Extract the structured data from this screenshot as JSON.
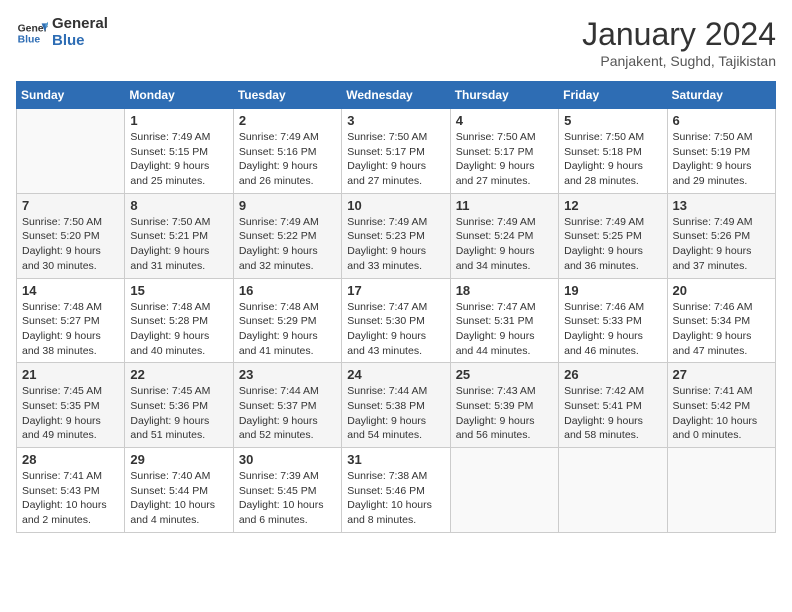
{
  "header": {
    "logo_line1": "General",
    "logo_line2": "Blue",
    "month": "January 2024",
    "location": "Panjakent, Sughd, Tajikistan"
  },
  "days_of_week": [
    "Sunday",
    "Monday",
    "Tuesday",
    "Wednesday",
    "Thursday",
    "Friday",
    "Saturday"
  ],
  "weeks": [
    [
      {
        "day": "",
        "info": ""
      },
      {
        "day": "1",
        "info": "Sunrise: 7:49 AM\nSunset: 5:15 PM\nDaylight: 9 hours\nand 25 minutes."
      },
      {
        "day": "2",
        "info": "Sunrise: 7:49 AM\nSunset: 5:16 PM\nDaylight: 9 hours\nand 26 minutes."
      },
      {
        "day": "3",
        "info": "Sunrise: 7:50 AM\nSunset: 5:17 PM\nDaylight: 9 hours\nand 27 minutes."
      },
      {
        "day": "4",
        "info": "Sunrise: 7:50 AM\nSunset: 5:17 PM\nDaylight: 9 hours\nand 27 minutes."
      },
      {
        "day": "5",
        "info": "Sunrise: 7:50 AM\nSunset: 5:18 PM\nDaylight: 9 hours\nand 28 minutes."
      },
      {
        "day": "6",
        "info": "Sunrise: 7:50 AM\nSunset: 5:19 PM\nDaylight: 9 hours\nand 29 minutes."
      }
    ],
    [
      {
        "day": "7",
        "info": "Sunrise: 7:50 AM\nSunset: 5:20 PM\nDaylight: 9 hours\nand 30 minutes."
      },
      {
        "day": "8",
        "info": "Sunrise: 7:50 AM\nSunset: 5:21 PM\nDaylight: 9 hours\nand 31 minutes."
      },
      {
        "day": "9",
        "info": "Sunrise: 7:49 AM\nSunset: 5:22 PM\nDaylight: 9 hours\nand 32 minutes."
      },
      {
        "day": "10",
        "info": "Sunrise: 7:49 AM\nSunset: 5:23 PM\nDaylight: 9 hours\nand 33 minutes."
      },
      {
        "day": "11",
        "info": "Sunrise: 7:49 AM\nSunset: 5:24 PM\nDaylight: 9 hours\nand 34 minutes."
      },
      {
        "day": "12",
        "info": "Sunrise: 7:49 AM\nSunset: 5:25 PM\nDaylight: 9 hours\nand 36 minutes."
      },
      {
        "day": "13",
        "info": "Sunrise: 7:49 AM\nSunset: 5:26 PM\nDaylight: 9 hours\nand 37 minutes."
      }
    ],
    [
      {
        "day": "14",
        "info": "Sunrise: 7:48 AM\nSunset: 5:27 PM\nDaylight: 9 hours\nand 38 minutes."
      },
      {
        "day": "15",
        "info": "Sunrise: 7:48 AM\nSunset: 5:28 PM\nDaylight: 9 hours\nand 40 minutes."
      },
      {
        "day": "16",
        "info": "Sunrise: 7:48 AM\nSunset: 5:29 PM\nDaylight: 9 hours\nand 41 minutes."
      },
      {
        "day": "17",
        "info": "Sunrise: 7:47 AM\nSunset: 5:30 PM\nDaylight: 9 hours\nand 43 minutes."
      },
      {
        "day": "18",
        "info": "Sunrise: 7:47 AM\nSunset: 5:31 PM\nDaylight: 9 hours\nand 44 minutes."
      },
      {
        "day": "19",
        "info": "Sunrise: 7:46 AM\nSunset: 5:33 PM\nDaylight: 9 hours\nand 46 minutes."
      },
      {
        "day": "20",
        "info": "Sunrise: 7:46 AM\nSunset: 5:34 PM\nDaylight: 9 hours\nand 47 minutes."
      }
    ],
    [
      {
        "day": "21",
        "info": "Sunrise: 7:45 AM\nSunset: 5:35 PM\nDaylight: 9 hours\nand 49 minutes."
      },
      {
        "day": "22",
        "info": "Sunrise: 7:45 AM\nSunset: 5:36 PM\nDaylight: 9 hours\nand 51 minutes."
      },
      {
        "day": "23",
        "info": "Sunrise: 7:44 AM\nSunset: 5:37 PM\nDaylight: 9 hours\nand 52 minutes."
      },
      {
        "day": "24",
        "info": "Sunrise: 7:44 AM\nSunset: 5:38 PM\nDaylight: 9 hours\nand 54 minutes."
      },
      {
        "day": "25",
        "info": "Sunrise: 7:43 AM\nSunset: 5:39 PM\nDaylight: 9 hours\nand 56 minutes."
      },
      {
        "day": "26",
        "info": "Sunrise: 7:42 AM\nSunset: 5:41 PM\nDaylight: 9 hours\nand 58 minutes."
      },
      {
        "day": "27",
        "info": "Sunrise: 7:41 AM\nSunset: 5:42 PM\nDaylight: 10 hours\nand 0 minutes."
      }
    ],
    [
      {
        "day": "28",
        "info": "Sunrise: 7:41 AM\nSunset: 5:43 PM\nDaylight: 10 hours\nand 2 minutes."
      },
      {
        "day": "29",
        "info": "Sunrise: 7:40 AM\nSunset: 5:44 PM\nDaylight: 10 hours\nand 4 minutes."
      },
      {
        "day": "30",
        "info": "Sunrise: 7:39 AM\nSunset: 5:45 PM\nDaylight: 10 hours\nand 6 minutes."
      },
      {
        "day": "31",
        "info": "Sunrise: 7:38 AM\nSunset: 5:46 PM\nDaylight: 10 hours\nand 8 minutes."
      },
      {
        "day": "",
        "info": ""
      },
      {
        "day": "",
        "info": ""
      },
      {
        "day": "",
        "info": ""
      }
    ]
  ]
}
